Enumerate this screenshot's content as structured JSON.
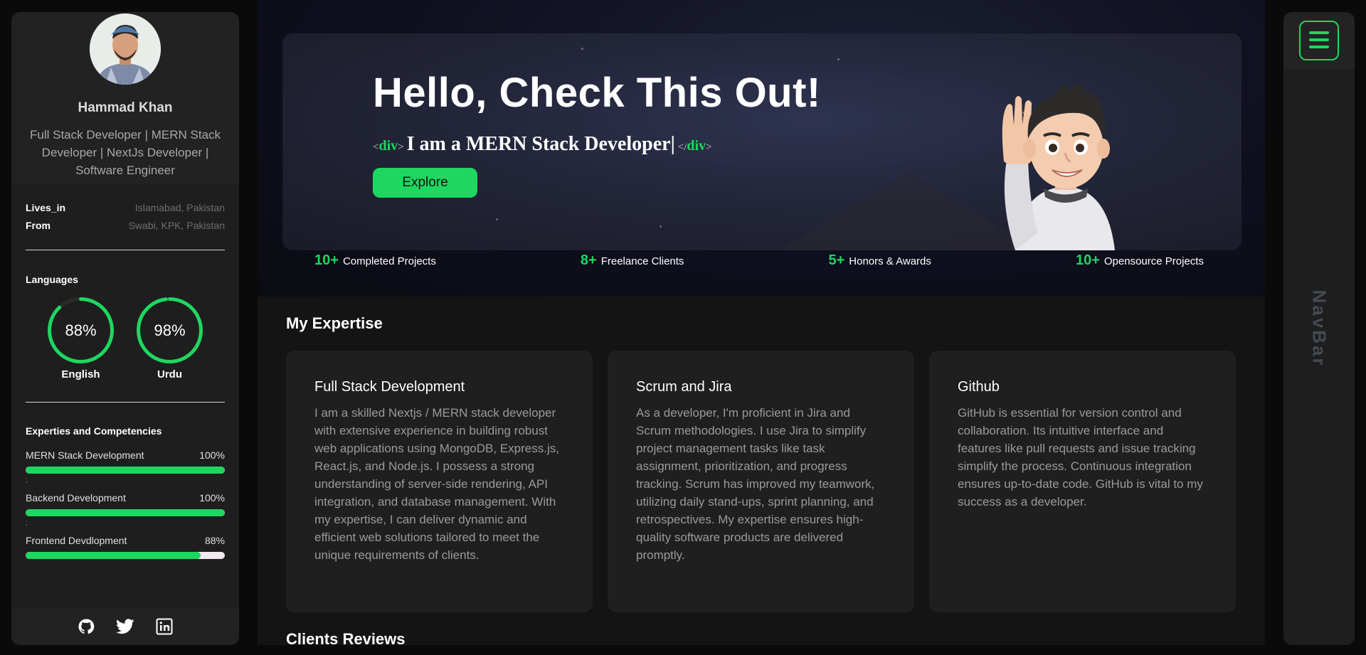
{
  "profile": {
    "name": "Hammad Khan",
    "title": "Full Stack Developer | MERN Stack Developer | NextJs Developer | Software Engineer",
    "info": [
      {
        "key": "Lives_in",
        "value": "Islamabad, Pakistan"
      },
      {
        "key": "From",
        "value": "Swabi, KPK, Pakistan"
      }
    ]
  },
  "languages": {
    "title": "Languages",
    "items": [
      {
        "name": "English",
        "percent_label": "88%",
        "percent": 88
      },
      {
        "name": "Urdu",
        "percent_label": "98%",
        "percent": 98
      }
    ]
  },
  "skills": {
    "title": "Experties and Competencies",
    "separator": ";",
    "items": [
      {
        "name": "MERN Stack Development",
        "percent_label": "100%",
        "percent": 100
      },
      {
        "name": "Backend Development",
        "percent_label": "100%",
        "percent": 100
      },
      {
        "name": "Frontend Devdlopment",
        "percent_label": "88%",
        "percent": 88
      }
    ]
  },
  "social": [
    "github-icon",
    "twitter-icon",
    "linkedin-icon"
  ],
  "hero": {
    "heading": "Hello, Check This Out!",
    "tag_open": "<",
    "tag_name": "div",
    "tag_close": ">",
    "tag_end_open": "</",
    "role": "I am a MERN Stack Developer|",
    "explore_label": "Explore"
  },
  "stats": [
    {
      "num": "10+",
      "label": "Completed Projects"
    },
    {
      "num": "8+",
      "label": "Freelance Clients"
    },
    {
      "num": "5+",
      "label": "Honors & Awards"
    },
    {
      "num": "10+",
      "label": "Opensource Projects"
    }
  ],
  "expertise": {
    "title": "My Expertise",
    "cards": [
      {
        "title": "Full Stack Development",
        "text": "I am a skilled Nextjs / MERN stack developer with extensive experience in building robust web applications using MongoDB, Express.js, React.js, and Node.js. I possess a strong understanding of server-side rendering, API integration, and database management. With my expertise, I can deliver dynamic and efficient web solutions tailored to meet the unique requirements of clients."
      },
      {
        "title": "Scrum and Jira",
        "text": "As a developer, I'm proficient in Jira and Scrum methodologies. I use Jira to simplify project management tasks like task assignment, prioritization, and progress tracking. Scrum has improved my teamwork, utilizing daily stand-ups, sprint planning, and retrospectives. My expertise ensures high-quality software products are delivered promptly."
      },
      {
        "title": "Github",
        "text": "GitHub is essential for version control and collaboration. Its intuitive interface and features like pull requests and issue tracking simplify the process. Continuous integration ensures up-to-date code. GitHub is vital to my success as a developer."
      }
    ]
  },
  "reviews": {
    "title": "Clients Reviews"
  },
  "rightnav": {
    "label": "NavBar",
    "menu_icon": "hamburger-icon"
  },
  "colors": {
    "accent": "#1ed760",
    "panel": "#1e1e1e",
    "background": "#0a0a0a"
  }
}
